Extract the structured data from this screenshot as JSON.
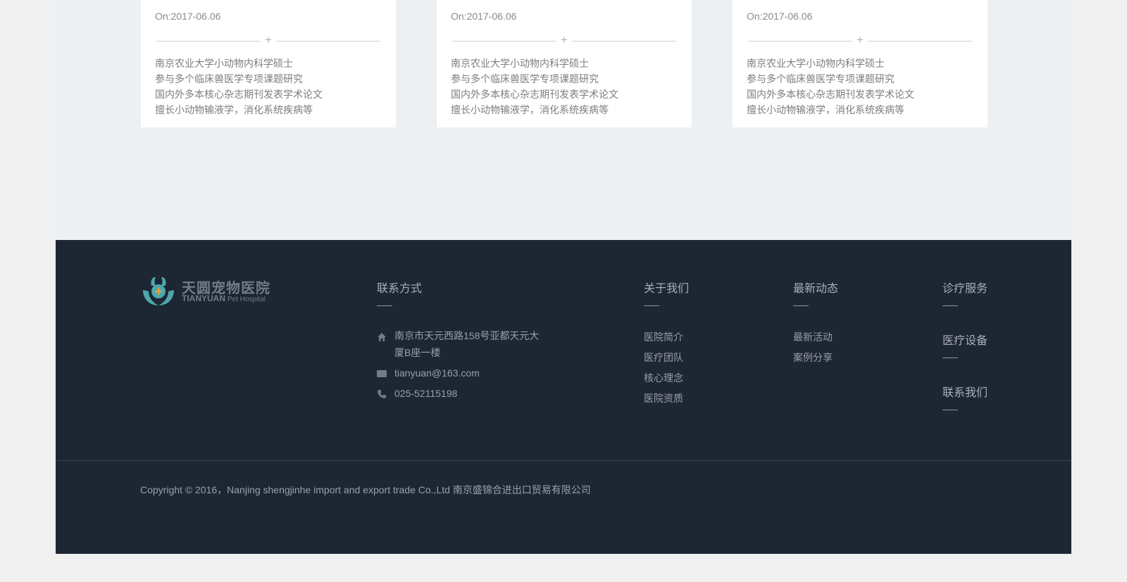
{
  "cards": [
    {
      "date": "On:2017-06.06",
      "lines": [
        "南京农业大学小动物内科学硕士",
        "参与多个临床兽医学专项课题研究",
        "国内外多本核心杂志期刊发表学术论文",
        "擅长小动物输液学，消化系统疾病等"
      ]
    },
    {
      "date": "On:2017-06.06",
      "lines": [
        "南京农业大学小动物内科学硕士",
        "参与多个临床兽医学专项课题研究",
        "国内外多本核心杂志期刊发表学术论文",
        "擅长小动物输液学，消化系统疾病等"
      ]
    },
    {
      "date": "On:2017-06.06",
      "lines": [
        "南京农业大学小动物内科学硕士",
        "参与多个临床兽医学专项课题研究",
        "国内外多本核心杂志期刊发表学术论文",
        "擅长小动物输液学，消化系统疾病等"
      ]
    }
  ],
  "footer": {
    "logo": {
      "name_cn": "天圆宠物医院",
      "name_en_bold": "TIANYUAN",
      "name_en_light": "Pet Hospital"
    },
    "contact": {
      "title": "联系方式",
      "address_line1": "南京市天元西路158号亚都天元大",
      "address_line2": "厦B座一楼",
      "email": "tianyuan@163.com",
      "phone": "025-52115198"
    },
    "about": {
      "title": "关于我们",
      "links": [
        "医院简介",
        "医疗团队",
        "核心理念",
        "医院资质"
      ]
    },
    "news": {
      "title": "最新动态",
      "links": [
        "最新活动",
        "案例分享"
      ]
    },
    "services": {
      "titles": [
        "诊疗服务",
        "医疗设备",
        "联系我们"
      ]
    },
    "copyright": "Copyright © 2016，Nanjing shengjinhe import and export trade Co.,Ltd 南京盛锦合进出口贸易有限公司"
  },
  "colors": {
    "footer_bg": "#1d2633",
    "content_bg": "#ecf0f3",
    "logo_accent": "#4fa6ad"
  },
  "icons": {
    "address": "home-icon",
    "email": "envelope-icon",
    "phone": "phone-icon"
  }
}
